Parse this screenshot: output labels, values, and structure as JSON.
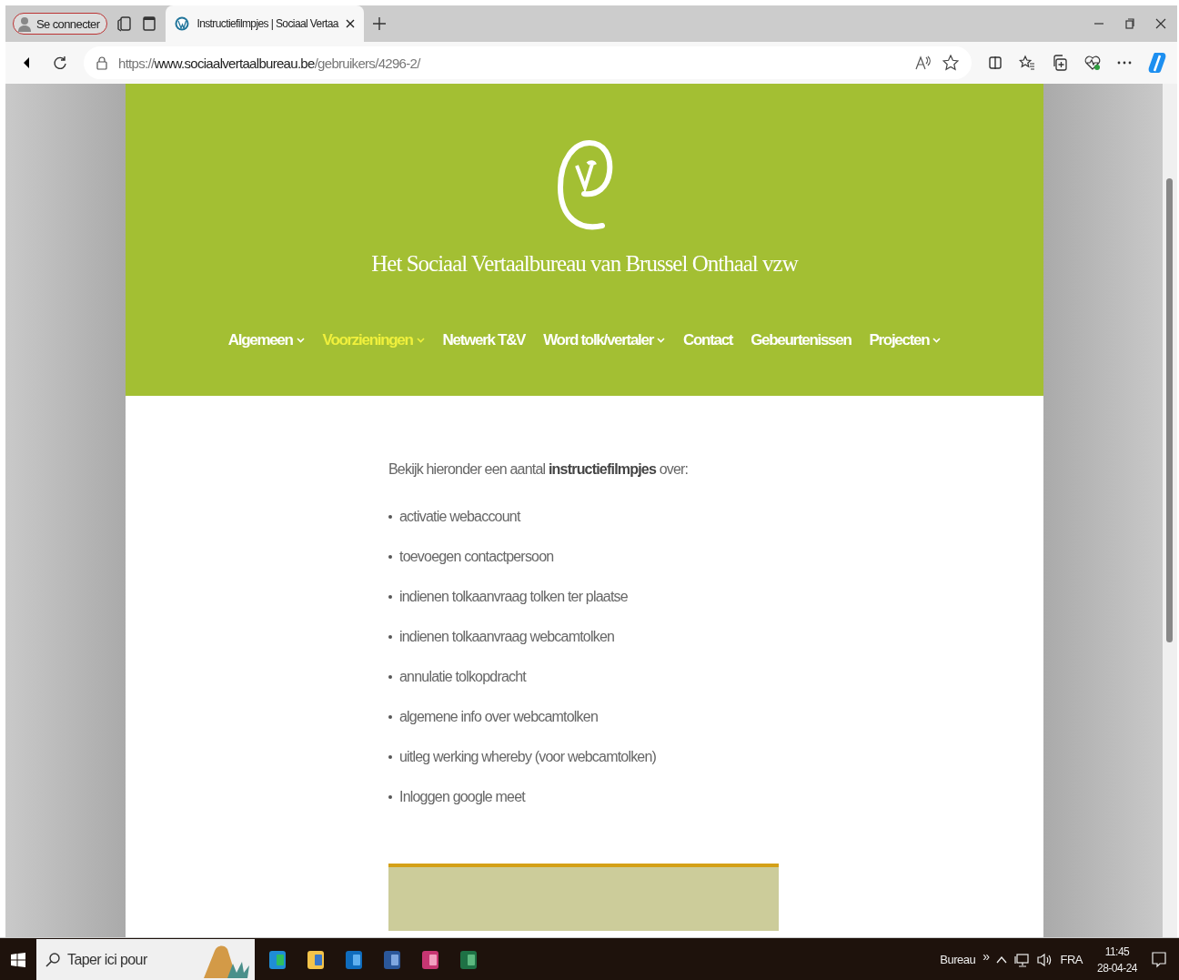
{
  "browser": {
    "profile": "Se connecter",
    "tab_title": "Instructiefilmpjes | Sociaal Vertaa",
    "url_scheme": "https://",
    "url_host": "www.sociaalvertaalbureau.be",
    "url_path": "/gebruikers/4296-2/"
  },
  "site": {
    "title": "Het Sociaal Vertaalbureau van Brussel Onthaal vzw",
    "nav": [
      {
        "label": "Algemeen",
        "dropdown": true,
        "selected": false
      },
      {
        "label": "Voorzieningen",
        "dropdown": true,
        "selected": true
      },
      {
        "label": "Netwerk T&V",
        "dropdown": false,
        "selected": false
      },
      {
        "label": "Word tolk/vertaler",
        "dropdown": true,
        "selected": false
      },
      {
        "label": "Contact",
        "dropdown": false,
        "selected": false
      },
      {
        "label": "Gebeurtenissen",
        "dropdown": false,
        "selected": false
      },
      {
        "label": "Projecten",
        "dropdown": true,
        "selected": false
      }
    ]
  },
  "content": {
    "intro": "Bekijk hieronder een aantal **instructiefilmpjes** over:",
    "items": [
      "activatie webaccount",
      "toevoegen contactpersoon",
      "indienen tolkaanvraag tolken ter plaatse",
      "indienen tolkaanvraag webcamtolken",
      "annulatie tolkopdracht",
      "algemene info over webcamtolken",
      "uitleg werking whereby (voor webcamtolken)",
      "Inloggen google meet"
    ]
  },
  "taskbar": {
    "search_placeholder": "Taper ici pour",
    "toolbar_label": "Bureau",
    "toolbar_more": "»",
    "language": "FRA",
    "time": "11:45",
    "date": "28-04-24"
  }
}
